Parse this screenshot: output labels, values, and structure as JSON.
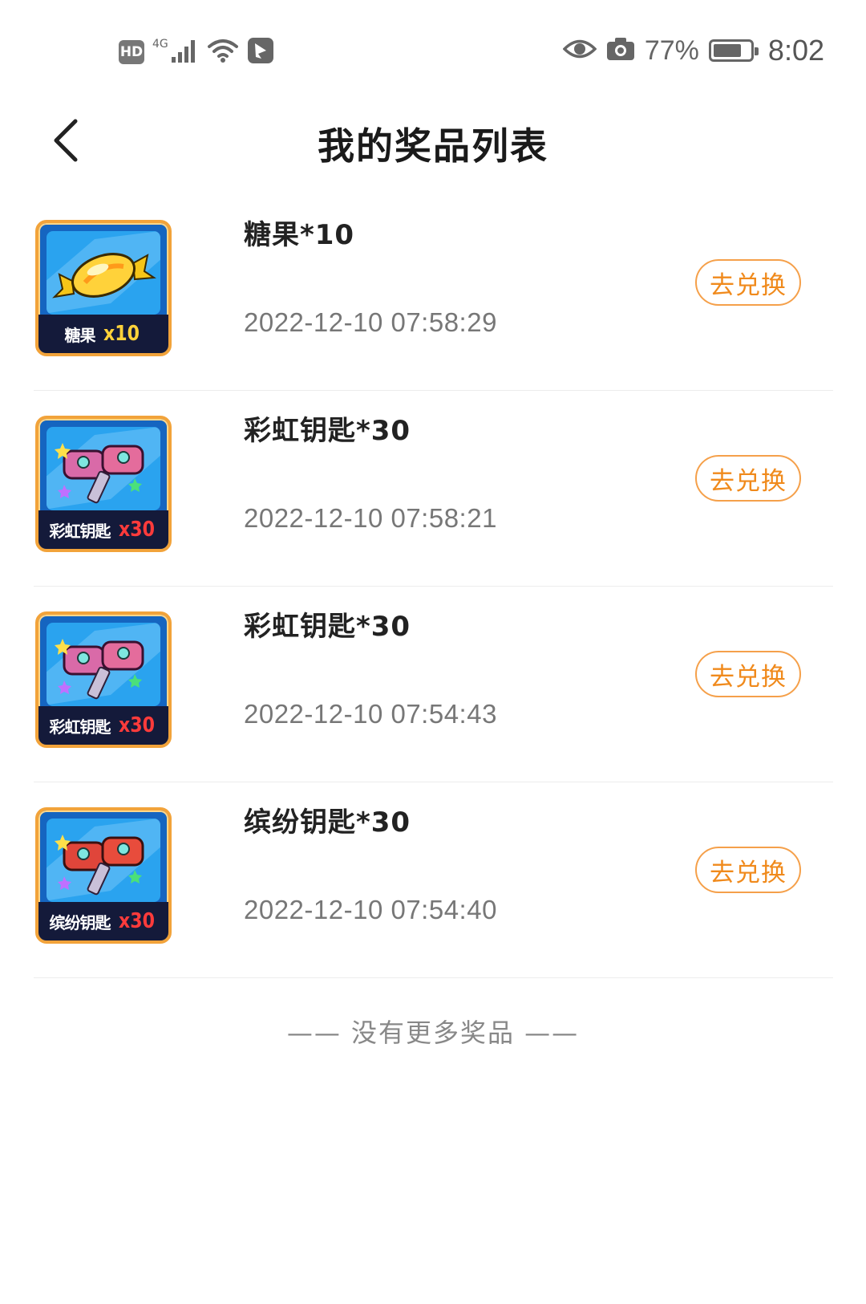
{
  "status_bar": {
    "hd": "HD",
    "network": "4G",
    "battery_percent": "77%",
    "battery_level": 0.77,
    "time": "8:02",
    "icons": [
      "signal-icon",
      "wifi-icon",
      "app-notification-icon",
      "eye-icon",
      "camera-icon",
      "battery-icon"
    ]
  },
  "header": {
    "title": "我的奖品列表",
    "back_icon": "chevron-left-icon"
  },
  "prizes": [
    {
      "name": "糖果*10",
      "time": "2022-12-10 07:58:29",
      "button": "去兑换",
      "thumb_name": "糖果",
      "thumb_qty": "x10",
      "thumb_type": "candy"
    },
    {
      "name": "彩虹钥匙*30",
      "time": "2022-12-10 07:58:21",
      "button": "去兑换",
      "thumb_name": "彩虹钥匙",
      "thumb_qty": "x30",
      "thumb_type": "rainbow-key"
    },
    {
      "name": "彩虹钥匙*30",
      "time": "2022-12-10 07:54:43",
      "button": "去兑换",
      "thumb_name": "彩虹钥匙",
      "thumb_qty": "x30",
      "thumb_type": "rainbow-key"
    },
    {
      "name": "缤纷钥匙*30",
      "time": "2022-12-10 07:54:40",
      "button": "去兑换",
      "thumb_name": "缤纷钥匙",
      "thumb_qty": "x30",
      "thumb_type": "colorful-key"
    }
  ],
  "footer": {
    "no_more": "—— 没有更多奖品 ——"
  },
  "colors": {
    "accent": "#f08a1c",
    "button_border": "#f5a04a",
    "thumb_border": "#f2a33a",
    "thumb_bg": "#2aa3ef",
    "thumb_label_bg": "#141a3a"
  }
}
